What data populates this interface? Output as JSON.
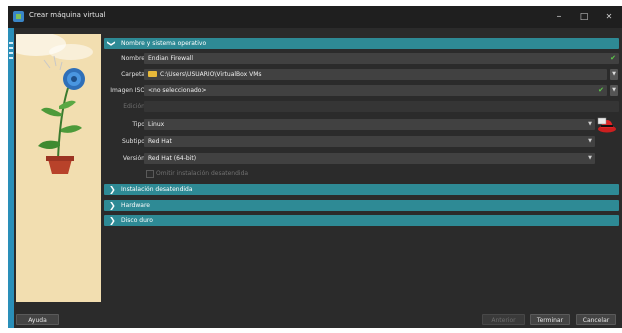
{
  "window": {
    "title": "Crear máquina virtual",
    "minimize": "–",
    "maximize": "□",
    "close": "✕"
  },
  "sections": [
    {
      "label": "Nombre y sistema operativo",
      "chevron": "❯"
    },
    {
      "label": "Instalación desatendida",
      "chevron": "❯"
    },
    {
      "label": "Hardware",
      "chevron": "❯"
    },
    {
      "label": "Disco duro",
      "chevron": "❯"
    }
  ],
  "form": {
    "nombre": {
      "label": "Nombre:",
      "value": "Endian Firewall"
    },
    "carpeta": {
      "label": "Carpeta:",
      "value": "C:\\Users\\USUARIO\\VirtualBox VMs"
    },
    "imagen": {
      "label": "Imagen ISO:",
      "value": "<no seleccionado>"
    },
    "edicion": {
      "label": "Edición:",
      "value": ""
    },
    "tipo": {
      "label": "Tipo:",
      "value": "Linux"
    },
    "subtipo": {
      "label": "Subtipo:",
      "value": "Red Hat"
    },
    "version": {
      "label": "Versión:",
      "value": "Red Hat (64-bit)"
    },
    "omitir": {
      "label": "Omitir instalación desatendida"
    }
  },
  "buttons": {
    "ayuda": "Ayuda",
    "anterior": "Anterior",
    "terminar": "Terminar",
    "cancelar": "Cancelar"
  },
  "colors": {
    "section_bar": "#2e8a95",
    "valid_check": "#5ecb4b",
    "left_strip": "#2a8fb9",
    "illustration_bg": "#f2deb0"
  },
  "icons": {
    "app": "virtualbox-icon",
    "os_type": "red-hat-icon",
    "valid": "checkmark-icon"
  }
}
